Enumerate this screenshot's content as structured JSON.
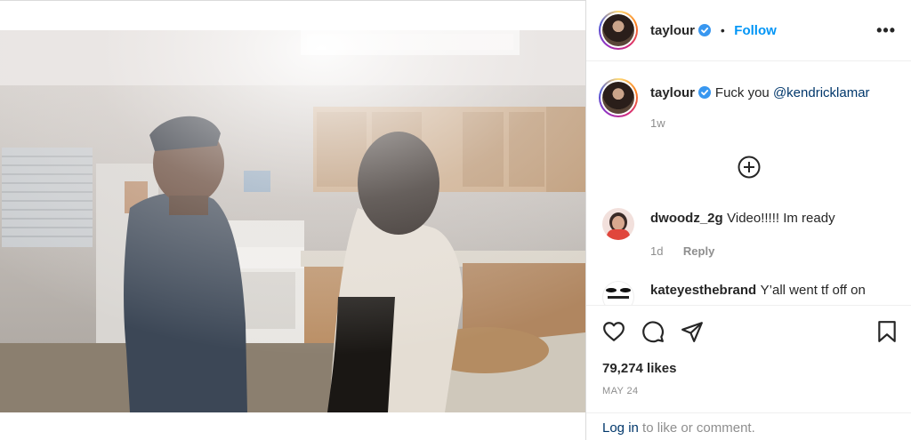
{
  "post": {
    "author": "taylour",
    "follow_label": "Follow",
    "separator": "•",
    "more_label": "•••",
    "caption": {
      "username": "taylour",
      "text": "Fuck you ",
      "mention": "@kendricklamar",
      "time": "1w"
    },
    "load_more_icon": "plus-circle-icon",
    "comments": [
      {
        "username": "dwoodz_2g",
        "text": "Video!!!!! Im ready",
        "time": "1d",
        "reply_label": "Reply"
      },
      {
        "username": "kateyesthebrand",
        "text": "Y’all went tf off on"
      }
    ],
    "likes": "79,274 likes",
    "date": "MAY 24",
    "login_link": "Log in",
    "login_text": " to like or comment."
  },
  "colors": {
    "accent": "#0095f6",
    "verified": "#3897f0",
    "mention": "#00376b",
    "muted": "#8e8e8e"
  }
}
